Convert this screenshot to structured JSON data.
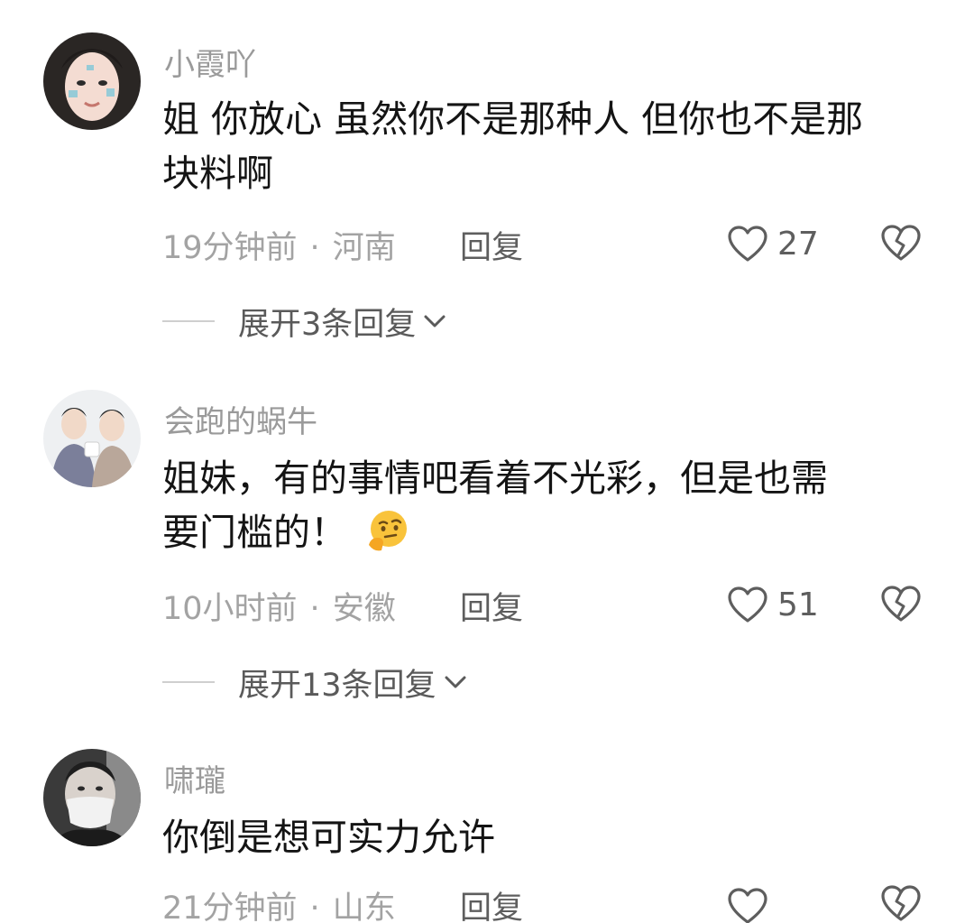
{
  "comments": [
    {
      "username": "小霞吖",
      "line1": "姐 你放心 虽然你不是那种人 但你也不是那",
      "line2": "块料啊",
      "time": "19分钟前",
      "location": "河南",
      "reply_label": "回复",
      "likes": "27",
      "expand_label": "展开3条回复",
      "avatar_icon": "avatar-girl-photo"
    },
    {
      "username": "会跑的蜗牛",
      "line1": "姐妹，有的事情吧看着不光彩，但是也需",
      "line2": "要门槛的！",
      "emoji": "thinking-face",
      "time": "10小时前",
      "location": "安徽",
      "reply_label": "回复",
      "likes": "51",
      "expand_label": "展开13条回复",
      "avatar_icon": "avatar-two-men-photo"
    },
    {
      "username": "啸瓏",
      "line1": "你倒是想可实力允许",
      "time": "21分钟前",
      "location": "山东",
      "reply_label": "回复",
      "avatar_icon": "avatar-masked-man-photo"
    }
  ],
  "separator": "·",
  "colors": {
    "background": "#ffffff",
    "username": "#9a9a9a",
    "text": "#141414",
    "meta": "#a3a3a3",
    "action": "#5e5e5e"
  }
}
